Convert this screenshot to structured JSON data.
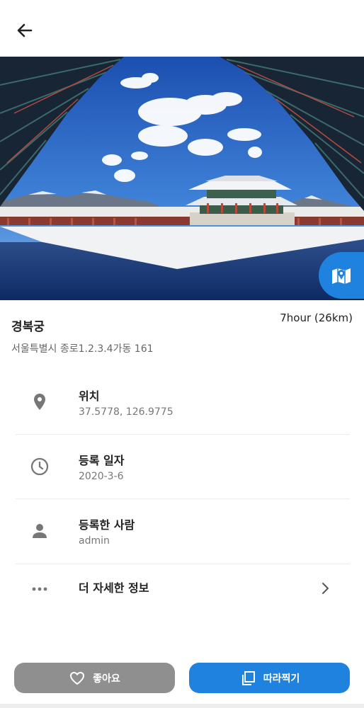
{
  "header": {
    "back_icon": "arrow-left-icon"
  },
  "hero": {
    "map_button_icon": "map-icon",
    "accent_color": "#1e82de"
  },
  "place": {
    "name": "경복궁",
    "duration": "7hour (26km)",
    "address": "서울특별시 종로1.2.3.4가동 161"
  },
  "details": [
    {
      "icon": "location-pin-icon",
      "label": "위치",
      "value": "37.5778, 126.9775"
    },
    {
      "icon": "clock-icon",
      "label": "등록 일자",
      "value": "2020-3-6"
    },
    {
      "icon": "person-icon",
      "label": "등록한 사람",
      "value": "admin"
    }
  ],
  "more": {
    "icon": "more-dots-icon",
    "label": "더 자세한 정보",
    "chevron_icon": "chevron-right-icon"
  },
  "actions": {
    "like_label": "좋아요",
    "like_icon": "heart-outline-icon",
    "like_color": "#8f8f8f",
    "follow_label": "따라찍기",
    "follow_icon": "copy-icon",
    "follow_color": "#1e82de"
  }
}
